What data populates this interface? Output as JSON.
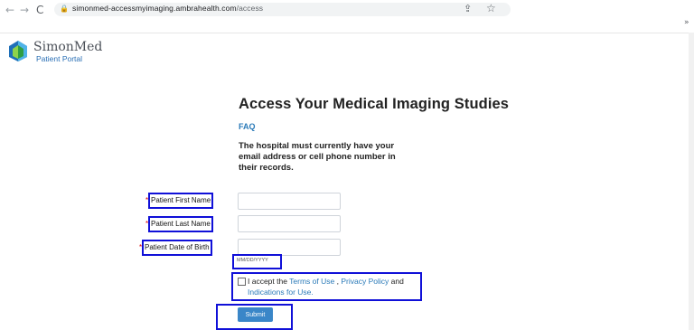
{
  "browser": {
    "back_icon": "arrow-left-icon",
    "forward_icon": "arrow-right-icon",
    "reload_icon": "reload-icon",
    "url_host": "simonmed-accessmyimaging.ambrahealth.com",
    "url_path": "/access",
    "overflow": "»"
  },
  "header": {
    "brand": "SimonMed",
    "subtitle": "Patient Portal"
  },
  "page": {
    "title": "Access Your Medical Imaging Studies",
    "faq": "FAQ",
    "description": "The hospital must currently have your email address or cell phone number in their records."
  },
  "form": {
    "first_name_label": "Patient First Name",
    "last_name_label": "Patient Last Name",
    "dob_label": "Patient Date of Birth",
    "required_marker": "*",
    "dob_hint": "MM/DD/YYYY",
    "first_name_value": "",
    "last_name_value": "",
    "dob_value": "",
    "accept_prefix": "I accept the",
    "terms": "Terms of Use",
    "comma": ",",
    "privacy": "Privacy Policy",
    "and": "and",
    "indications": "Indications for Use.",
    "submit": "Submit"
  },
  "colors": {
    "highlight": "#1010d8",
    "link": "#2a7ab8",
    "button": "#3a86c8",
    "brand_text": "#4a4f57"
  }
}
